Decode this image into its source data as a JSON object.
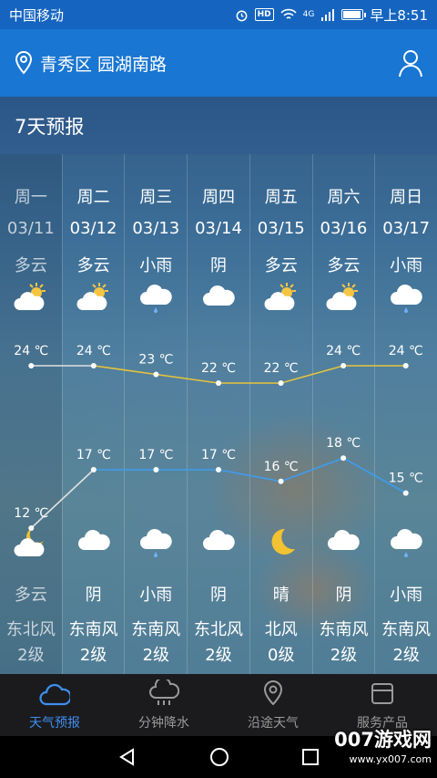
{
  "status_bar": {
    "carrier": "中国移动",
    "time": "早上8:51",
    "network": "4G",
    "hd": "HD",
    "battery_level": 0.85
  },
  "header": {
    "location": "青秀区 园湖南路",
    "icons": [
      "location-pin-icon",
      "user-icon"
    ]
  },
  "forecast": {
    "title": "7天预报",
    "days": [
      {
        "day": "周一",
        "date": "03/11",
        "day_cond": "多云",
        "day_icon": "partly-cloudy-icon",
        "high": "24 ℃",
        "low": "12 ℃",
        "night_icon": "moon-cloud-icon",
        "night_cond": "多云",
        "wind": "东北风",
        "level": "2级"
      },
      {
        "day": "周二",
        "date": "03/12",
        "day_cond": "多云",
        "day_icon": "partly-cloudy-icon",
        "high": "24 ℃",
        "low": "17 ℃",
        "night_icon": "cloud-icon",
        "night_cond": "阴",
        "wind": "东南风",
        "level": "2级"
      },
      {
        "day": "周三",
        "date": "03/13",
        "day_cond": "小雨",
        "day_icon": "rain-icon",
        "high": "23 ℃",
        "low": "17 ℃",
        "night_icon": "rain-icon",
        "night_cond": "小雨",
        "wind": "东南风",
        "level": "2级"
      },
      {
        "day": "周四",
        "date": "03/14",
        "day_cond": "阴",
        "day_icon": "cloud-icon",
        "high": "22 ℃",
        "low": "17 ℃",
        "night_icon": "cloud-icon",
        "night_cond": "阴",
        "wind": "东北风",
        "level": "2级"
      },
      {
        "day": "周五",
        "date": "03/15",
        "day_cond": "多云",
        "day_icon": "partly-cloudy-icon",
        "high": "22 ℃",
        "low": "16 ℃",
        "night_icon": "moon-icon",
        "night_cond": "晴",
        "wind": "北风",
        "level": "0级"
      },
      {
        "day": "周六",
        "date": "03/16",
        "day_cond": "多云",
        "day_icon": "partly-cloudy-icon",
        "high": "24 ℃",
        "low": "18 ℃",
        "night_icon": "cloud-icon",
        "night_cond": "阴",
        "wind": "东南风",
        "level": "2级"
      },
      {
        "day": "周日",
        "date": "03/17",
        "day_cond": "小雨",
        "day_icon": "rain-icon",
        "high": "24 ℃",
        "low": "15 ℃",
        "night_icon": "rain-icon",
        "night_cond": "小雨",
        "wind": "东南风",
        "level": "2级"
      }
    ],
    "high_values": [
      24,
      24,
      23,
      22,
      22,
      24,
      24
    ],
    "low_values": [
      12,
      17,
      17,
      17,
      16,
      18,
      15
    ],
    "colors": {
      "high_line": "#e8c43a",
      "low_line": "#3d9df0",
      "past_line": "#e0e0e0",
      "moon": "#f2c230",
      "sun": "#f5c542"
    }
  },
  "bottom_nav": {
    "items": [
      {
        "label": "天气预报",
        "icon": "cloud-icon",
        "active": true
      },
      {
        "label": "分钟降水",
        "icon": "rain-cloud-icon",
        "active": false
      },
      {
        "label": "沿途天气",
        "icon": "route-pin-icon",
        "active": false
      },
      {
        "label": "服务产品",
        "icon": "box-icon",
        "active": false
      }
    ]
  },
  "watermark": {
    "brand": "007游戏网",
    "url": "www.yx007.com"
  }
}
